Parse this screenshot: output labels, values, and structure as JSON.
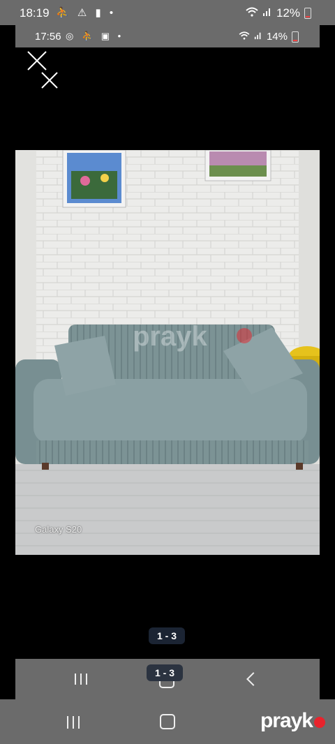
{
  "status_bar": {
    "time": "18:19",
    "battery": "12%"
  },
  "inner_status_bar": {
    "time": "17:56",
    "battery": "14%"
  },
  "photo": {
    "label": "Galaxy S20",
    "watermark": "prayko"
  },
  "gallery": {
    "counter_top": "1 - 3",
    "counter_bottom": "1 - 3"
  },
  "brand": {
    "logo_text": "prayk",
    "accent_color": "#e8232c"
  },
  "icons": {
    "close": "close-icon",
    "recents": "recents-icon",
    "home": "home-icon",
    "back": "back-icon",
    "wifi": "wifi-icon",
    "signal": "signal-icon",
    "battery": "battery-icon"
  }
}
